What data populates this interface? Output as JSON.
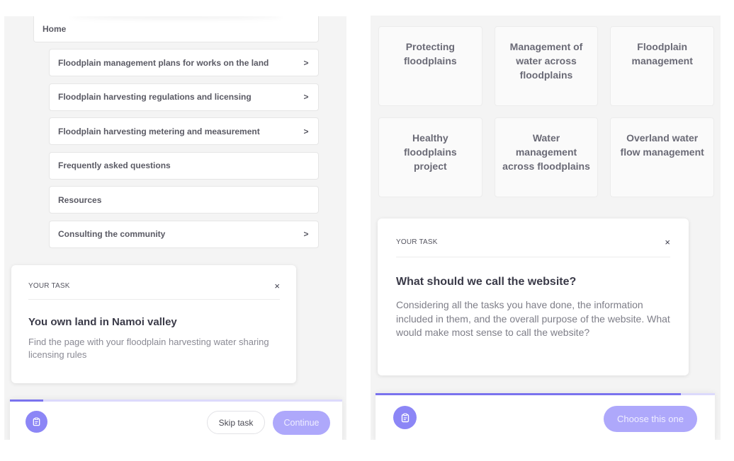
{
  "left": {
    "home_label": "Home",
    "nav_items": [
      {
        "label": "Floodplain management plans for works on the land",
        "has_children": true
      },
      {
        "label": "Floodplain harvesting regulations and licensing",
        "has_children": true
      },
      {
        "label": "Floodplain harvesting metering and measurement",
        "has_children": true
      },
      {
        "label": "Frequently asked questions",
        "has_children": false
      },
      {
        "label": "Resources",
        "has_children": false
      },
      {
        "label": "Consulting the community",
        "has_children": true
      }
    ],
    "chevron_glyph": ">",
    "task": {
      "label": "YOUR TASK",
      "close_glyph": "×",
      "title": "You own land in Namoi valley",
      "description": "Find the page with your floodplain harvesting water sharing licensing rules"
    },
    "footer": {
      "progress_percent": 10,
      "skip_label": "Skip task",
      "continue_label": "Continue"
    }
  },
  "right": {
    "cards": [
      [
        "Protecting floodplains",
        "Management of water across floodplains",
        "Floodplain management"
      ],
      [
        "Healthy floodplains project",
        "Water management across floodplains",
        "Overland water flow management"
      ]
    ],
    "task": {
      "label": "YOUR TASK",
      "close_glyph": "×",
      "title": "What should we call the website?",
      "description": "Considering all the tasks you have done, the information included in them, and the overall purpose of the website. What would make most sense to call the website?"
    },
    "footer": {
      "progress_percent": 90,
      "choose_label": "Choose this one"
    }
  },
  "colors": {
    "accent": "#8c86f6",
    "accent_light": "#aea8fb",
    "progress": "#7a73ee",
    "progress_track": "#dcdafc",
    "panel_bg": "#f4f4f4"
  }
}
